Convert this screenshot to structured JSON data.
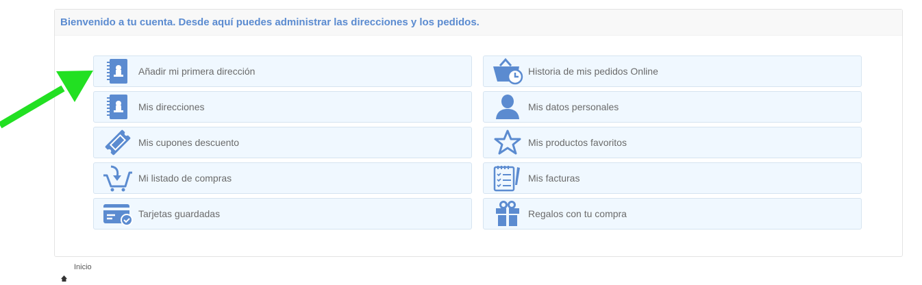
{
  "header": {
    "welcome": "Bienvenido a tu cuenta. Desde aquí puedes administrar las direcciones y los pedidos."
  },
  "items": [
    {
      "label": "Añadir mi primera dirección",
      "icon": "address-book-icon"
    },
    {
      "label": "Historia de mis pedidos Online",
      "icon": "basket-clock-icon"
    },
    {
      "label": "Mis direcciones",
      "icon": "address-book-icon"
    },
    {
      "label": "Mis datos personales",
      "icon": "user-icon"
    },
    {
      "label": "Mis cupones descuento",
      "icon": "coupon-icon"
    },
    {
      "label": "Mis productos favoritos",
      "icon": "star-icon"
    },
    {
      "label": "Mi listado de compras",
      "icon": "cart-icon"
    },
    {
      "label": "Mis facturas",
      "icon": "invoice-icon"
    },
    {
      "label": "Tarjetas guardadas",
      "icon": "credit-card-icon"
    },
    {
      "label": "Regalos con tu compra",
      "icon": "gift-icon"
    }
  ],
  "footer": {
    "home_label": "Inicio"
  },
  "colors": {
    "icon": "#5b8bd0",
    "accent_arrow": "#22e022",
    "header_text": "#5b8bd0"
  }
}
